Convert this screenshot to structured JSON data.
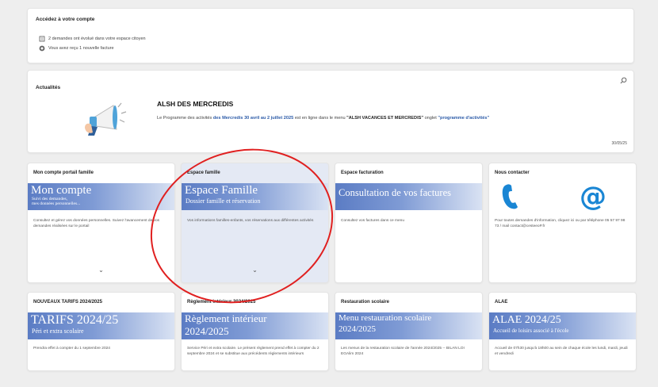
{
  "acces": {
    "title": "Accédez à votre compte",
    "line1": "2 demandes ont évolué dans votre espace citoyen",
    "line2": "Vous avez reçu 1 nouvelle facture"
  },
  "actualites": {
    "title": "Actualités",
    "news_title": "ALSH DES MERCREDIS",
    "text_pre": "Le Programme des activités ",
    "text_hl1": "des Mercredis 30 avril au 2 juillet 2025",
    "text_mid": " est en ligne dans le menu ",
    "text_dk1": "\"ALSH VACANCES ET MERCREDIS\"",
    "text_mid2": "  onglet ",
    "text_hl2": "\"programme d'activités\"",
    "date": "30/05/25"
  },
  "cards_row1": [
    {
      "title": "Mon compte portail famille",
      "banner": "Mon compte",
      "sub1": "Suivi des demandes,",
      "sub2": "mes données personnelles...",
      "desc": "Consultez et gérez vos données personnelles. Suivez l'avancement de vos demandes réalisées sur le portail"
    },
    {
      "title": "Espace famille",
      "banner": "Espace Famille",
      "sub1": "Dossier famille et réservation",
      "desc": "Vos informations familles-enfants, vos réservations aux différentes activités"
    },
    {
      "title": "Espace facturation",
      "banner": "Consultation de vos factures",
      "desc": "Consultez vos factures dans ce menu"
    },
    {
      "title": "Nous contacter",
      "desc": "Pour toutes demandes d'information, cliquez ici ou par téléphone 05 57 97 98 73 / mail contact@cesteeoP.fr",
      "icon_phone": "phone-icon",
      "icon_at": "at-sign-icon"
    }
  ],
  "cards_row2": [
    {
      "title": "NOUVEAUX TARIFS 2024/2025",
      "banner": "TARIFS 2024/25",
      "sub1": "Péri et extra scolaire",
      "desc": "Prendra effet à compter du 1 septembre 2024"
    },
    {
      "title": "Règlement intérieur 2024/2025",
      "banner1": "Règlement intérieur",
      "banner2": "2024/2025",
      "desc": "Service Péri et extra scolaire. Le présent règlement prend effet à compter du 2 septembre 2024 et se substitue aux précédents règlements intérieurs"
    },
    {
      "title": "Restauration scolaire",
      "banner1": "Menu restauration scolaire",
      "banner2": "2024/2025",
      "desc": "Les menus de la restauration scolaire de l'année 2024/2025 -- BILAN LOI EGAlim 2024"
    },
    {
      "title": "ALAE",
      "banner": "ALAE 2024/25",
      "sub1": "Accueil de loisirs associé à l'école",
      "desc": "Accueil de 07h30 jusqu'à 18h00 au sein de chaque école les lundi, mardi, jeudi et vendredi"
    }
  ],
  "colors": {
    "banner_start": "#5b7cc4",
    "banner_end": "#d9e2f3",
    "accent_blue": "#2c5ba8",
    "annotation_red": "#e02020",
    "contact_blue": "#1a86d4"
  }
}
